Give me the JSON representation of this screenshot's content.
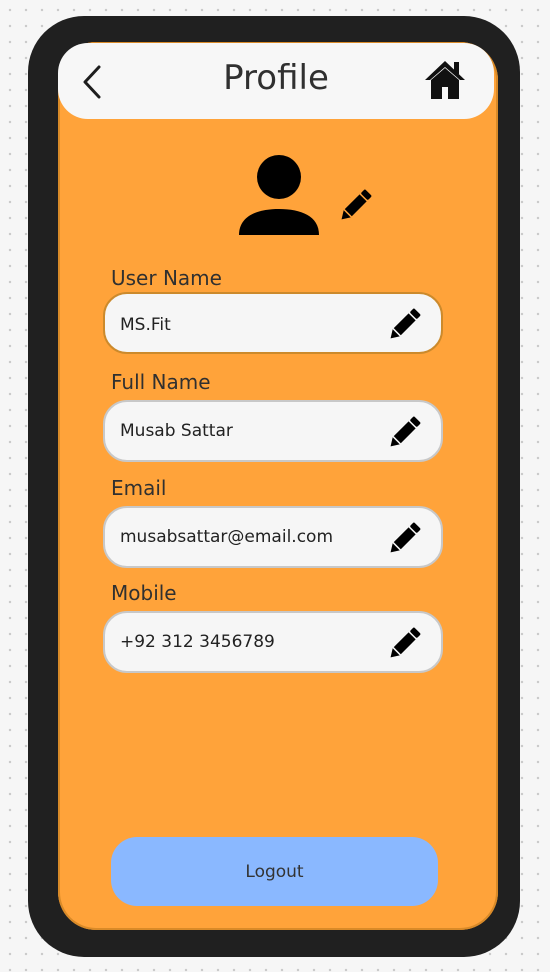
{
  "header": {
    "title": "Profile",
    "back_icon": "chevron-left-icon",
    "home_icon": "home-icon"
  },
  "profile": {
    "avatar_icon": "user-icon",
    "edit_icon": "pencil-icon"
  },
  "fields": [
    {
      "label": "User Name",
      "value": "MS.Fit"
    },
    {
      "label": "Full Name",
      "value": "Musab Sattar"
    },
    {
      "label": "Email",
      "value": "musabsattar@email.com"
    },
    {
      "label": "Mobile",
      "value": "+92 312 3456789"
    }
  ],
  "logout_label": "Logout",
  "colors": {
    "frame": "#202020",
    "screen": "#ffa33a",
    "card": "#f7f7f7",
    "logout": "#8ab8ff",
    "text": "#303030"
  }
}
